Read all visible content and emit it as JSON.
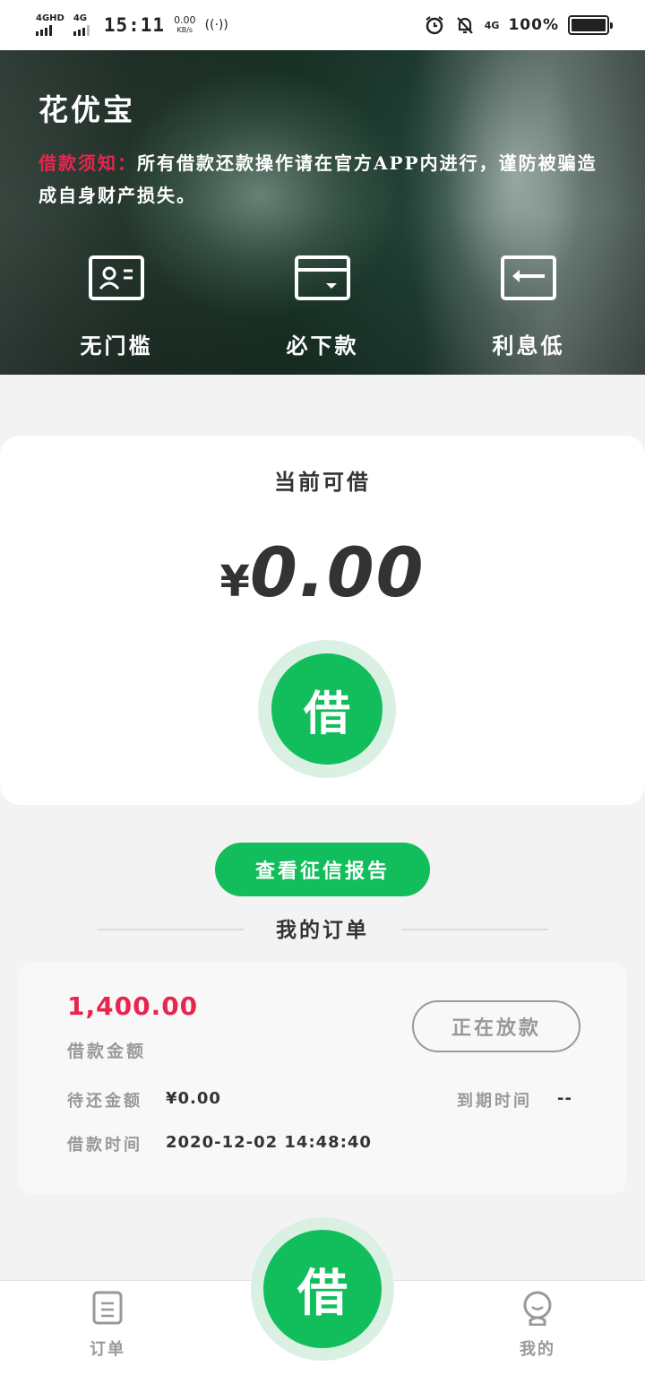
{
  "status_bar": {
    "sim1": "4GHD",
    "sim2": "4G",
    "time": "15:11",
    "net_speed": "0.00",
    "net_unit": "KB/s",
    "sim2_tag": "4G",
    "battery_pct": "100%"
  },
  "hero": {
    "app_title": "花优宝",
    "notice_label": "借款须知：",
    "notice_text": "所有借款还款操作请在官方APP内进行，谨防被骗造成自身财产损失。",
    "features": [
      {
        "label": "无门槛",
        "icon": "id-card-icon"
      },
      {
        "label": "必下款",
        "icon": "wallet-card-icon"
      },
      {
        "label": "利息低",
        "icon": "return-arrow-icon"
      }
    ]
  },
  "loan": {
    "caption": "当前可借",
    "currency": "¥",
    "amount": "0.00",
    "borrow_button": "借"
  },
  "credit_report_button": "查看征信报告",
  "orders": {
    "title": "我的订单",
    "items": [
      {
        "amount": "1,400.00",
        "amount_label": "借款金额",
        "status": "正在放款",
        "pending_label": "待还金额",
        "pending_value": "¥0.00",
        "due_label": "到期时间",
        "due_value": "--",
        "time_label": "借款时间",
        "time_value": "2020-12-02 14:48:40"
      }
    ]
  },
  "bottom_nav": {
    "orders_label": "订单",
    "fab_label": "借",
    "mine_label": "我的"
  },
  "colors": {
    "accent_green": "#12be5b",
    "accent_green_light": "#d9f0e2",
    "alert_red": "#e8254e",
    "muted_text": "#999999"
  }
}
